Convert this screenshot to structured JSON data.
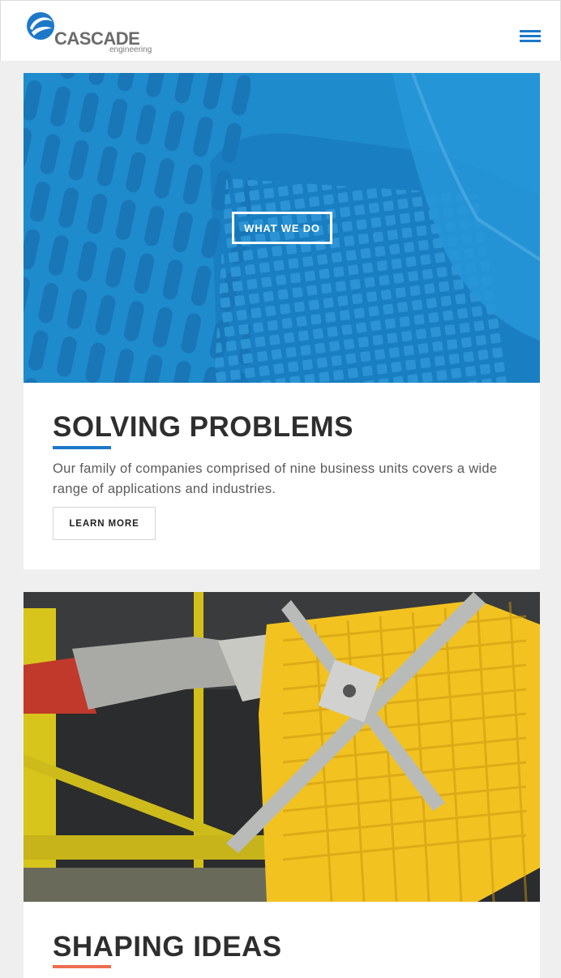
{
  "header": {
    "logo_name": "CASCADE",
    "logo_sub": "engineering",
    "menu_icon": "hamburger-menu-icon",
    "accent_color": "#1e78c8"
  },
  "cards": [
    {
      "button_label": "WHAT WE DO",
      "title": "SOLVING PROBLEMS",
      "text": "Our family of companies comprised of nine business units covers a wide range of applications and industries.",
      "cta_label": "LEARN MORE",
      "accent_color": "#1e78c8"
    },
    {
      "title": "SHAPING IDEAS",
      "accent_color": "#ee6d50"
    }
  ]
}
